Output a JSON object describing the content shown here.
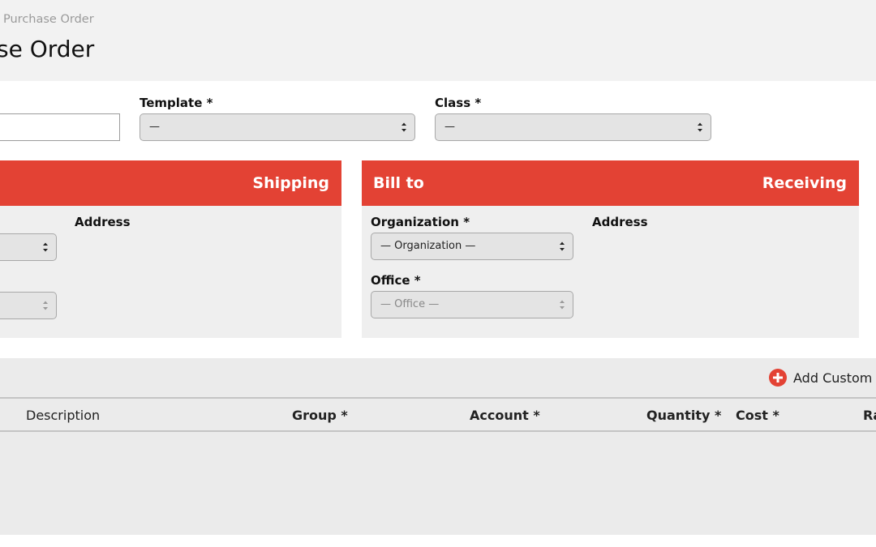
{
  "header": {
    "breadcrumb": "Purchase Order",
    "title": "se Order"
  },
  "form": {
    "template_label": "Template *",
    "template_value": "—",
    "class_label": "Class *",
    "class_value": "—"
  },
  "shipping": {
    "title": "Shipping",
    "address_label": "Address"
  },
  "bill_to": {
    "title": "Bill to",
    "receiving_label": "Receiving",
    "organization_label": "Organization *",
    "organization_value": "— Organization —",
    "address_label": "Address",
    "office_label": "Office *",
    "office_value": "— Office —"
  },
  "items": {
    "add_custom_label": "Add Custom",
    "columns": {
      "description": "Description",
      "group": "Group *",
      "account": "Account *",
      "quantity": "Quantity *",
      "cost": "Cost *",
      "rate": "Ra"
    }
  },
  "colors": {
    "accent": "#e34234",
    "panel_bg": "#efefef",
    "header_bg": "#f2f2f2"
  },
  "icons": {
    "select_arrows": "up-down-chevron-icon",
    "add": "plus-circle-icon"
  }
}
